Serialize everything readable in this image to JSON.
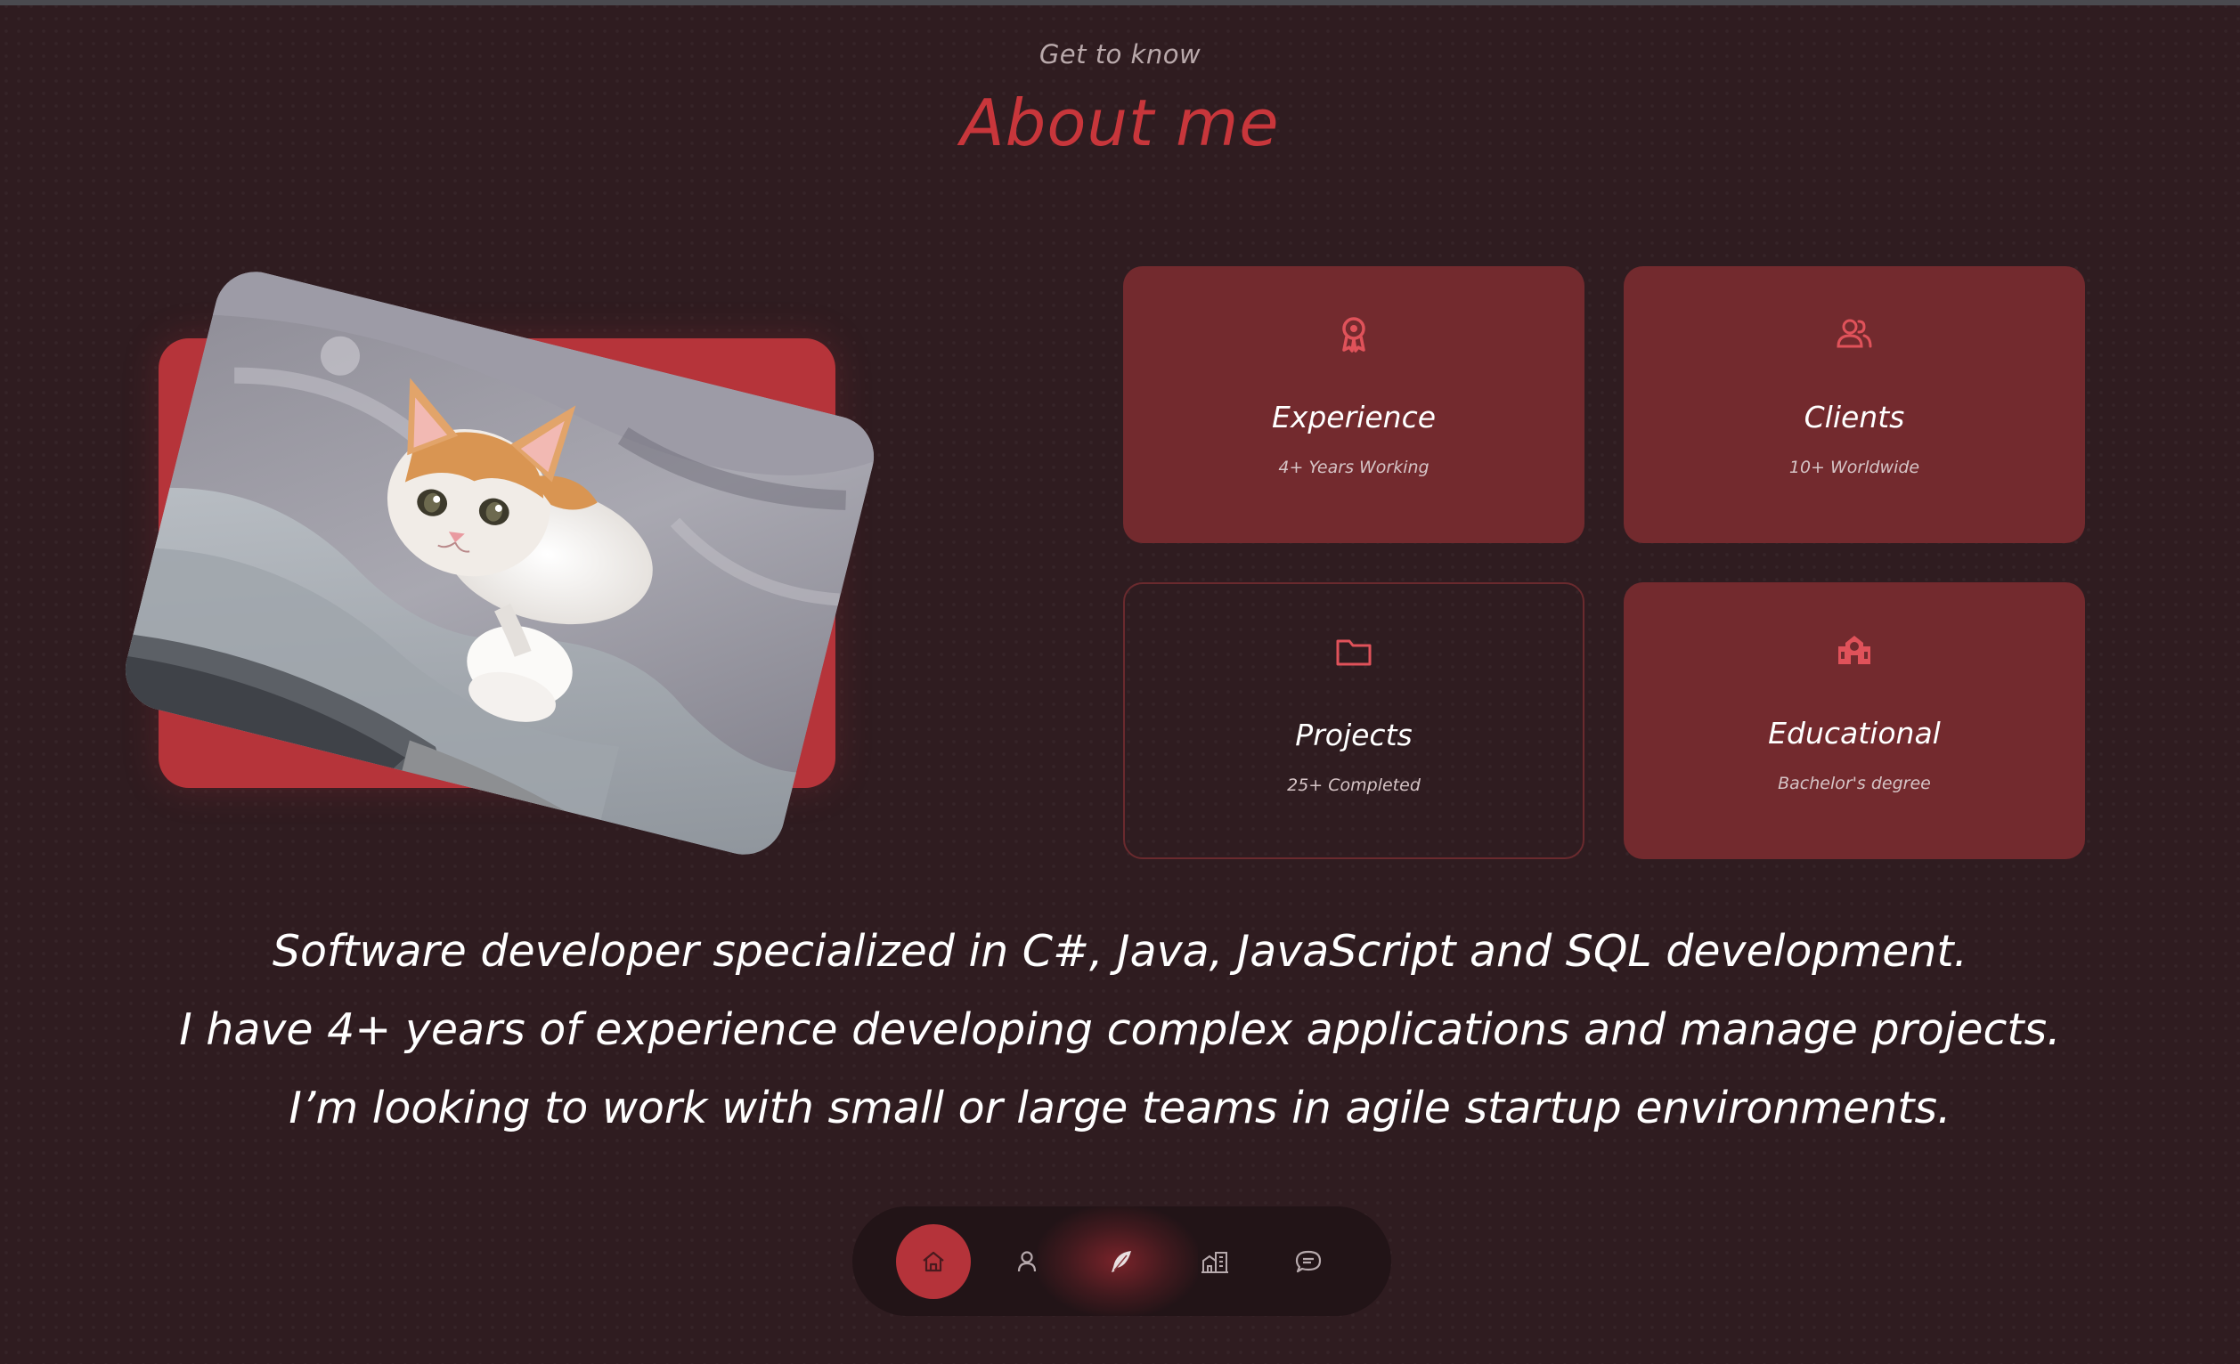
{
  "header": {
    "eyebrow": "Get to know",
    "title": "About me"
  },
  "photo": {
    "subject": "kitten-photo"
  },
  "cards": [
    {
      "icon": "award-icon",
      "title": "Experience",
      "subtitle": "4+ Years Working"
    },
    {
      "icon": "users-icon",
      "title": "Clients",
      "subtitle": "10+ Worldwide"
    },
    {
      "icon": "folder-icon",
      "title": "Projects",
      "subtitle": "25+ Completed"
    },
    {
      "icon": "school-icon",
      "title": "Educational",
      "subtitle": "Bachelor's degree"
    }
  ],
  "bio": {
    "line1": "Software developer specialized in C#, Java, JavaScript and SQL development.",
    "line2": "I have 4+ years of experience developing complex applications and manage projects.",
    "line3": "I’m looking to work with small or large teams in agile startup environments."
  },
  "nav": {
    "items": [
      {
        "icon": "home-icon",
        "active": true
      },
      {
        "icon": "user-icon",
        "active": false
      },
      {
        "icon": "feather-icon",
        "active": false
      },
      {
        "icon": "building-icon",
        "active": false
      },
      {
        "icon": "chat-icon",
        "active": false
      }
    ]
  },
  "colors": {
    "background": "#2f1c20",
    "accent": "#c8363b",
    "card": "#732a2e",
    "nav": "#221417"
  }
}
